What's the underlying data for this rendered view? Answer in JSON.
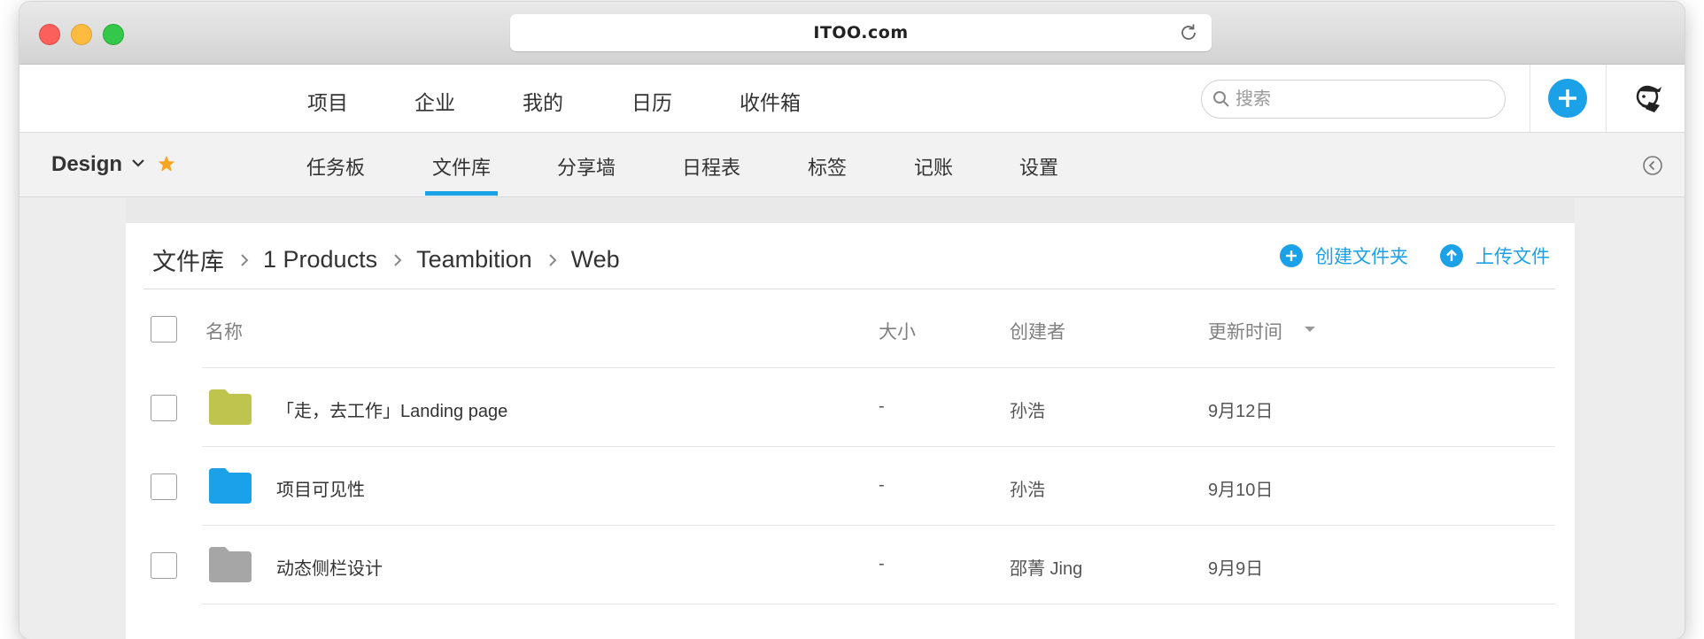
{
  "browser": {
    "url": "ITOO.com"
  },
  "topnav": {
    "items": [
      "项目",
      "企业",
      "我的",
      "日历",
      "收件箱"
    ],
    "search_placeholder": "搜索"
  },
  "subnav": {
    "project": "Design",
    "tabs": [
      "任务板",
      "文件库",
      "分享墙",
      "日程表",
      "标签",
      "记账",
      "设置"
    ],
    "active_tab": "文件库"
  },
  "breadcrumb": [
    "文件库",
    "1 Products",
    "Teambition",
    "Web"
  ],
  "actions": {
    "create_folder": "创建文件夹",
    "upload_file": "上传文件"
  },
  "table": {
    "headers": {
      "name": "名称",
      "size": "大小",
      "creator": "创建者",
      "updated": "更新时间"
    },
    "rows": [
      {
        "name": "「走，去工作」Landing page",
        "size": "-",
        "creator": "孙浩",
        "updated": "9月12日",
        "folder_color": "#bfc44f"
      },
      {
        "name": "项目可见性",
        "size": "-",
        "creator": "孙浩",
        "updated": "9月10日",
        "folder_color": "#1ba1e8"
      },
      {
        "name": "动态侧栏设计",
        "size": "-",
        "creator": "邵菁 Jing",
        "updated": "9月9日",
        "folder_color": "#a6a6a6"
      }
    ]
  },
  "colors": {
    "accent": "#1ba1e8",
    "star": "#f5a623"
  }
}
